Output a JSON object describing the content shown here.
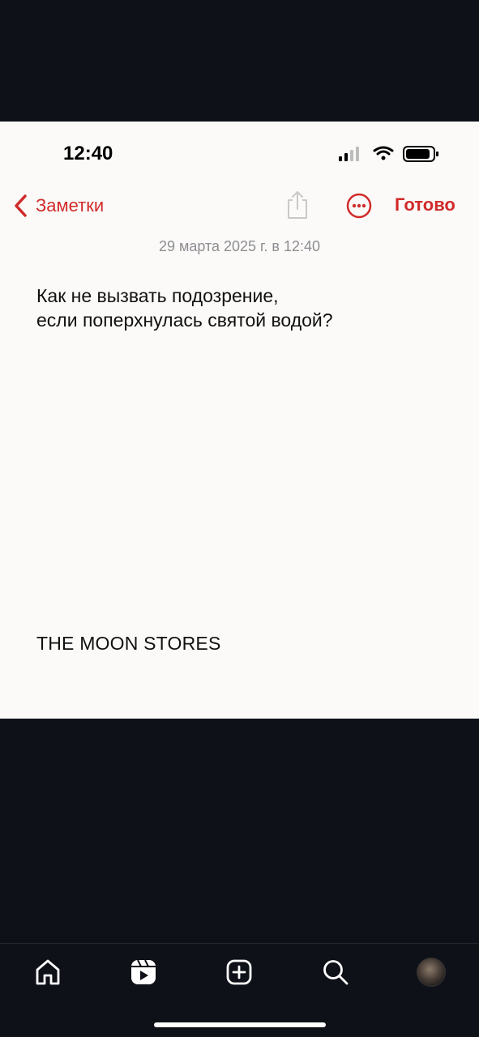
{
  "status_bar": {
    "time": "12:40"
  },
  "nav": {
    "back_label": "Заметки",
    "done_label": "Готово"
  },
  "note": {
    "date": "29 марта 2025 г. в 12:40",
    "lines": [
      "Как не вызвать подозрение,",
      "если поперхнулась святой водой?"
    ],
    "signature": "THE MOON STORES"
  },
  "colors": {
    "accent": "#d12a2a",
    "note_background": "#fbfaf8",
    "app_background": "#0e1117",
    "date_text": "#8d8d92"
  },
  "tab_bar": {
    "items": [
      "home-icon",
      "reels-icon",
      "create-icon",
      "search-icon",
      "profile-avatar"
    ]
  }
}
